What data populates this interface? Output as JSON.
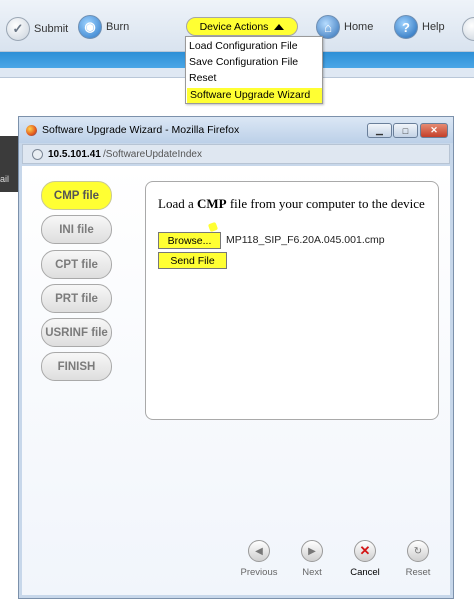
{
  "toolbar": {
    "submit_label": "Submit",
    "burn_label": "Burn",
    "device_actions_label": "Device Actions",
    "home_label": "Home",
    "help_label": "Help",
    "icons": {
      "submit": "check-circle-icon",
      "burn": "burn-disc-icon",
      "home": "home-icon",
      "help": "help-icon"
    }
  },
  "menu": {
    "items": [
      {
        "label": "Load Configuration File"
      },
      {
        "label": "Save Configuration File"
      },
      {
        "label": "Reset"
      },
      {
        "label": "Software Upgrade Wizard"
      }
    ],
    "highlight_color": "#ffff33"
  },
  "left_strip_label": "ail",
  "window": {
    "title": "Software Upgrade Wizard - Mozilla Firefox",
    "address_host": "10.5.101.41",
    "address_path": "/SoftwareUpdateIndex"
  },
  "wizard": {
    "steps": [
      {
        "label": "CMP file"
      },
      {
        "label": "INI file"
      },
      {
        "label": "CPT file"
      },
      {
        "label": "PRT file"
      },
      {
        "label": "USRINF file"
      },
      {
        "label": "FINISH"
      }
    ],
    "active_step": "CMP file",
    "instruction_prefix": "Load a ",
    "instruction_bold": "CMP",
    "instruction_suffix": " file from your computer to the device",
    "browse_label": "Browse...",
    "selected_file": "MP118_SIP_F6.20A.045.001.cmp",
    "send_label": "Send File"
  },
  "nav": {
    "previous": "Previous",
    "next": "Next",
    "cancel": "Cancel",
    "reset": "Reset"
  },
  "colors": {
    "highlight": "#ffff33",
    "toolbar_band": "#2d8fd6",
    "window_frame": "#c7d7ea"
  }
}
